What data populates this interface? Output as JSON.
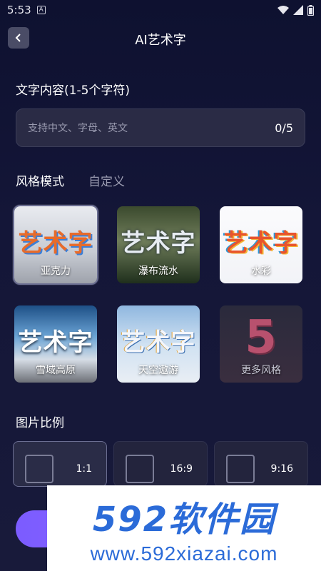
{
  "status_bar": {
    "time": "5:53",
    "badge": "A"
  },
  "header": {
    "title": "AI艺术字",
    "back_icon": "chevron-left-icon"
  },
  "text_section": {
    "label": "文字内容(1-5个字符)",
    "placeholder": "支持中文、字母、英文",
    "count": "0/5"
  },
  "tabs": [
    {
      "label": "风格模式",
      "active": true
    },
    {
      "label": "自定义",
      "active": false
    }
  ],
  "styles": [
    {
      "label": "亚克力",
      "thumb_text": "艺术字",
      "selected": true
    },
    {
      "label": "瀑布流水",
      "thumb_text": "艺术字",
      "selected": false
    },
    {
      "label": "水彩",
      "thumb_text": "艺术字",
      "selected": false
    },
    {
      "label": "雪域高原",
      "thumb_text": "艺术字",
      "selected": false
    },
    {
      "label": "天空遨游",
      "thumb_text": "艺术字",
      "selected": false
    },
    {
      "label": "更多风格",
      "thumb_text": "5",
      "selected": false
    }
  ],
  "ratio_section": {
    "label": "图片比例",
    "options": [
      {
        "label": "1:1",
        "selected": true
      },
      {
        "label": "16:9",
        "selected": false
      },
      {
        "label": "9:16",
        "selected": false
      }
    ]
  },
  "watermark": {
    "brand": "592软件园",
    "url": "www.592xiazai.com"
  },
  "colors": {
    "accent": "#8a63ff",
    "input_bg": "#2a2b45",
    "watermark_blue": "#2b6bd8"
  }
}
